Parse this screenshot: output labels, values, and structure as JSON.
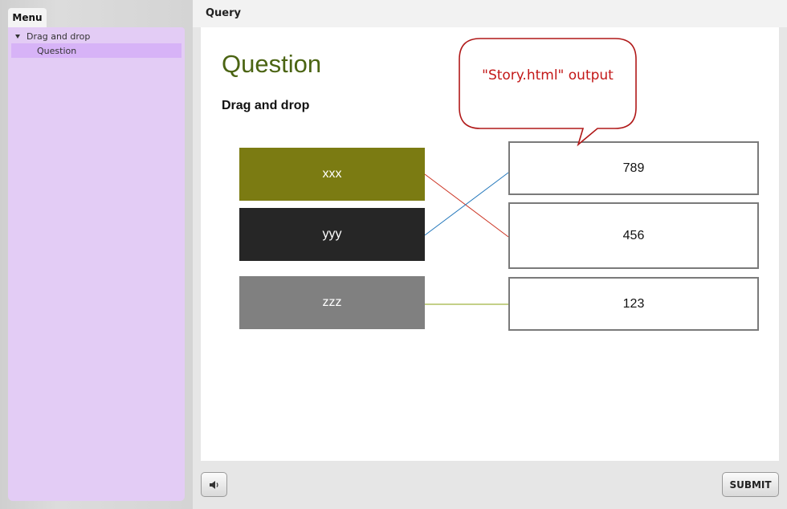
{
  "sidebar": {
    "tab_label": "Menu",
    "tree": {
      "parent_label": "Drag and drop",
      "child_label": "Question"
    }
  },
  "header": {
    "title": "Query"
  },
  "slide": {
    "title": "Question",
    "subtitle": "Drag and drop",
    "drag_items": [
      {
        "label": "xxx",
        "color": "#7b7b12"
      },
      {
        "label": "yyy",
        "color": "#262626"
      },
      {
        "label": "zzz",
        "color": "#808080"
      }
    ],
    "drop_targets": [
      {
        "label": "789"
      },
      {
        "label": "456"
      },
      {
        "label": "123"
      }
    ],
    "connections": [
      {
        "from": "xxx",
        "to": "456",
        "color": "#cc3322"
      },
      {
        "from": "yyy",
        "to": "789",
        "color": "#2277bb"
      },
      {
        "from": "zzz",
        "to": "123",
        "color": "#8aa012"
      }
    ],
    "callout": {
      "text": "\"Story.html\" output",
      "color": "#c31818"
    }
  },
  "footer": {
    "audio_icon": "speaker-icon",
    "submit_label": "SUBMIT"
  }
}
